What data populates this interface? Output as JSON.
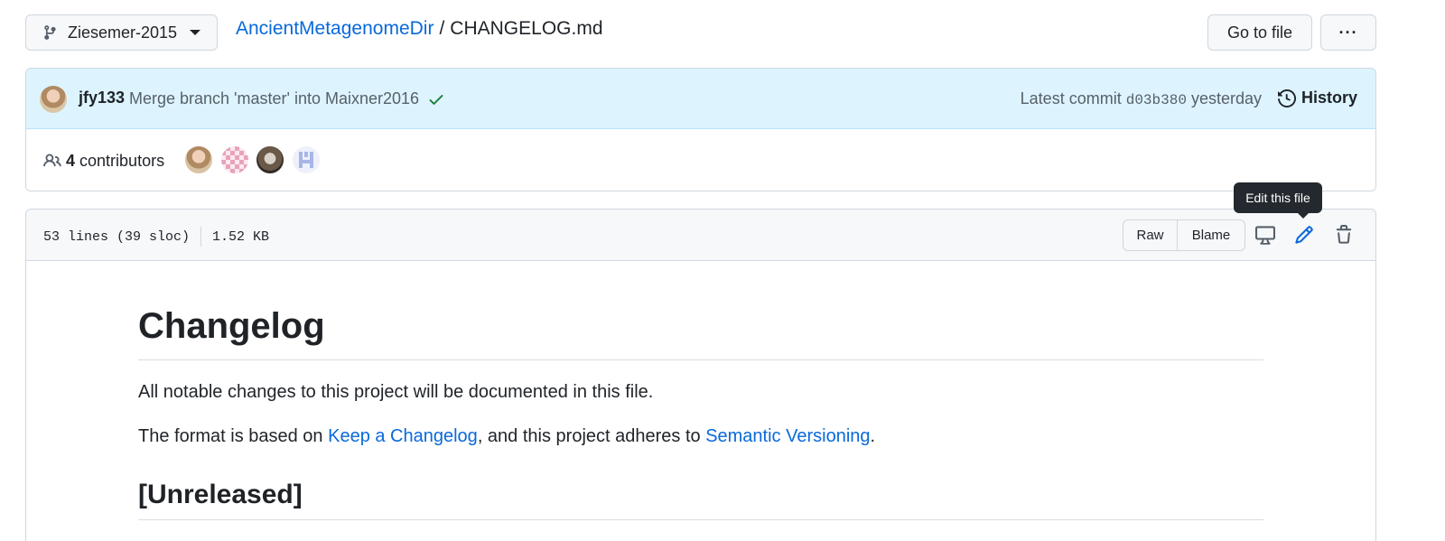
{
  "header": {
    "branch": "Ziesemer-2015",
    "repo": "AncientMetagenomeDir",
    "separator": "/",
    "file": "CHANGELOG.md",
    "goto_label": "Go to file",
    "more_label": "···"
  },
  "commit": {
    "author": "jfy133",
    "message": "Merge branch 'master' into Maixner2016",
    "latest_label": "Latest commit",
    "sha": "d03b380",
    "when": "yesterday",
    "history_label": "History"
  },
  "contributors": {
    "count": "4",
    "label": "contributors"
  },
  "tooltip": "Edit this file",
  "file_header": {
    "lines": "53 lines (39 sloc)",
    "size": "1.52 KB",
    "raw_label": "Raw",
    "blame_label": "Blame"
  },
  "markdown": {
    "h1": "Changelog",
    "p1": "All notable changes to this project will be documented in this file.",
    "p2_prefix": "The format is based on ",
    "p2_link1": "Keep a Changelog",
    "p2_middle": ", and this project adheres to ",
    "p2_link2": "Semantic Versioning",
    "p2_suffix": ".",
    "h2": "[Unreleased]"
  },
  "colors": {
    "link": "#0969da",
    "commit_bg": "#ddf4ff",
    "success": "#1a7f37"
  }
}
